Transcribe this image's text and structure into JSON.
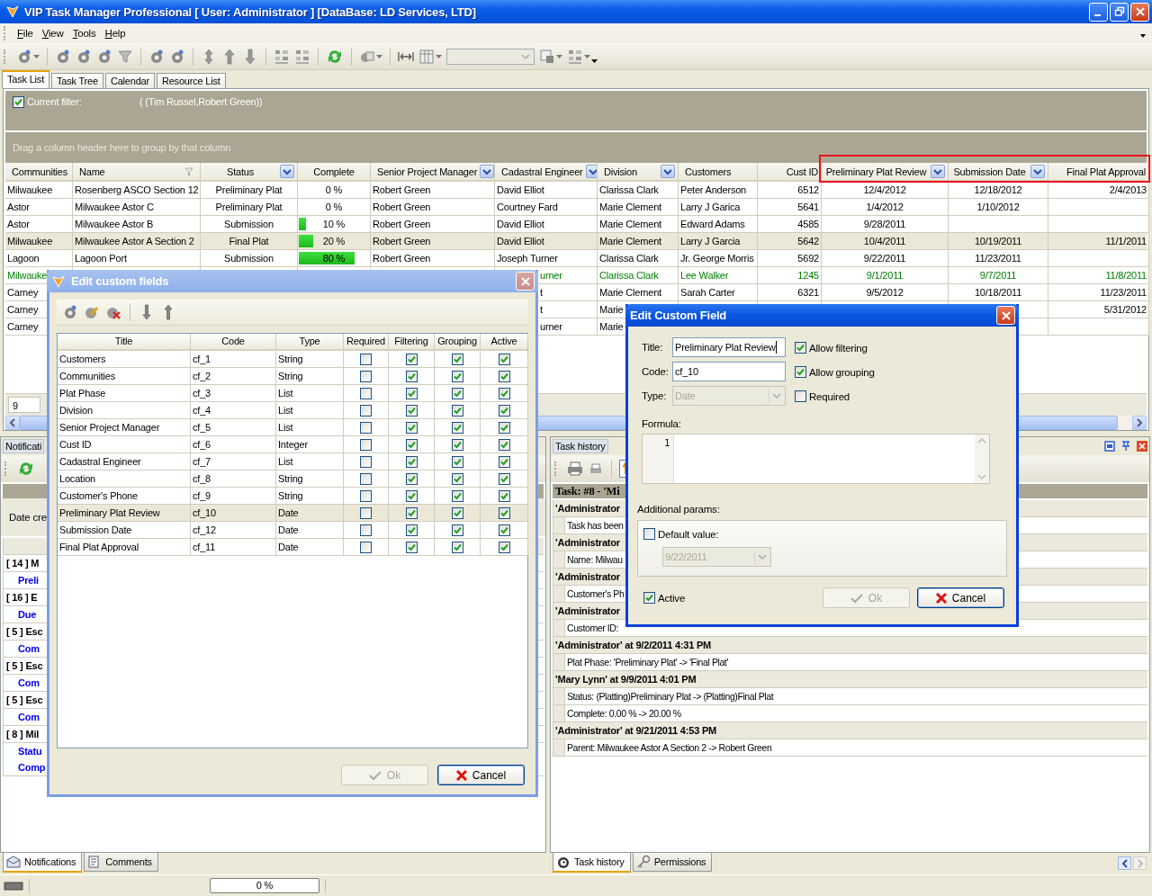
{
  "window": {
    "title": "VIP Task Manager Professional [ User: Administrator ] [DataBase: LD Services, LTD]"
  },
  "menu": [
    "File",
    "View",
    "Tools",
    "Help"
  ],
  "view_tabs": [
    {
      "label": "Task List",
      "selected": true
    },
    {
      "label": "Task Tree",
      "selected": false
    },
    {
      "label": "Calendar",
      "selected": false
    },
    {
      "label": "Resource List",
      "selected": false
    }
  ],
  "filter": {
    "checked": true,
    "label": "Current filter:",
    "value": "( (Tim Russel,Robert Green))"
  },
  "group_hint": "Drag a column header here to group by that column",
  "grid": {
    "columns": [
      {
        "label": "Communities",
        "menu_button": false,
        "funnel": false
      },
      {
        "label": "Name",
        "menu_button": false,
        "funnel": true
      },
      {
        "label": "Status",
        "menu_button": true,
        "funnel": false
      },
      {
        "label": "Complete",
        "menu_button": false,
        "funnel": false
      },
      {
        "label": "Senior Project Manager",
        "menu_button": true,
        "funnel": false
      },
      {
        "label": "Cadastral Engineer",
        "menu_button": true,
        "funnel": false
      },
      {
        "label": "Division",
        "menu_button": true,
        "funnel": false
      },
      {
        "label": "Customers",
        "menu_button": false,
        "funnel": false
      },
      {
        "label": "Cust ID",
        "menu_button": false,
        "funnel": false
      },
      {
        "label": "Preliminary Plat Review",
        "menu_button": true,
        "funnel": false,
        "marked": true
      },
      {
        "label": "Submission Date",
        "menu_button": true,
        "funnel": false,
        "marked": true
      },
      {
        "label": "Final Plat Approval",
        "menu_button": false,
        "funnel": false,
        "marked": true
      }
    ],
    "rows": [
      {
        "selected": false,
        "cells": [
          "Milwaukee",
          "Rosenberg ASCO Section 12",
          "Preliminary Plat",
          "0 %",
          "Robert Green",
          "David Elliot",
          "Clarissa Clark",
          "Peter Anderson",
          "6512",
          "12/4/2012",
          "12/18/2012",
          "2/4/2013"
        ]
      },
      {
        "selected": false,
        "cells": [
          "Astor",
          "Milwaukee Astor C",
          "Preliminary Plat",
          "0 %",
          "Robert Green",
          "Courtney Fard",
          "Marie Clement",
          "Larry J Garica",
          "5641",
          "1/4/2012",
          "1/10/2012",
          null
        ]
      },
      {
        "selected": false,
        "level": 0.1,
        "cells": [
          "Astor",
          "Milwaukee Astor B",
          "Submission",
          "10 %",
          "Robert Green",
          "David Elliot",
          "Marie Clement",
          "Edward Adams",
          "4585",
          "9/28/2011",
          null,
          null
        ]
      },
      {
        "selected": true,
        "level": 0.2,
        "cells": [
          "Milwaukee",
          "Milwaukee  Astor A Section 2",
          "Final Plat",
          "20 %",
          "Robert Green",
          "David Elliot",
          "Marie Clement",
          "Larry J Garcia",
          "5642",
          "10/4/2011",
          "10/19/2011",
          "11/1/2011"
        ]
      },
      {
        "selected": false,
        "level": 0.8,
        "cells": [
          "Lagoon",
          "Lagoon Port",
          "Submission",
          "80 %",
          "Robert Green",
          "Joseph Turner",
          "Clarissa Clark",
          "Jr. George Morris",
          "5692",
          "9/22/2011",
          "11/23/2011",
          null
        ]
      },
      {
        "selected": false,
        "color": "#008000",
        "cells": [
          "Milwauke",
          null,
          null,
          null,
          null,
          {
            "text": "urner",
            "cut": true
          },
          "Clarissa Clark",
          "Lee Walker",
          "1245",
          "9/1/2011",
          "9/7/2011",
          "11/8/2011"
        ]
      },
      {
        "selected": false,
        "cells": [
          "Carney",
          null,
          null,
          null,
          null,
          {
            "text": "t",
            "cut": true
          },
          "Marie Clement",
          "Sarah Carter",
          "6321",
          "9/5/2012",
          "10/18/2011",
          "11/23/2011"
        ]
      },
      {
        "selected": false,
        "cells": [
          "Carney",
          null,
          null,
          null,
          null,
          {
            "text": "t",
            "cut": true
          },
          "Marie",
          null,
          null,
          null,
          null,
          "5/31/2012"
        ]
      },
      {
        "selected": false,
        "cells": [
          "Carney",
          null,
          null,
          null,
          null,
          {
            "text": "urner",
            "cut": true
          },
          "Marie",
          null,
          null,
          null,
          null,
          null
        ]
      }
    ],
    "footer_count": "9"
  },
  "notifications_panel": {
    "title": "Notificati",
    "column_header": "Date cre",
    "items": [
      {
        "title": "[ 14 ] M",
        "details": [
          "Preli"
        ]
      },
      {
        "title": "[ 16 ] E",
        "details": [
          "Due"
        ]
      },
      {
        "title": "[ 5 ] Esc",
        "details": [
          "Com"
        ]
      },
      {
        "title": "[ 5 ] Esc",
        "details": [
          "Com"
        ]
      },
      {
        "title": "[ 5 ] Esc",
        "details": [
          "Com"
        ]
      },
      {
        "title": "[ 8 ] Mil",
        "details": [
          "Statu",
          "Comp"
        ]
      }
    ]
  },
  "history_panel": {
    "title": "Task history",
    "task": "Task: #8 - 'Mi",
    "entries": [
      {
        "header": "'Administrator",
        "changes": [
          "Task has been"
        ]
      },
      {
        "header": "'Administrator",
        "changes": [
          "Name: Milwau"
        ]
      },
      {
        "header": "'Administrator",
        "changes": [
          "Customer's Ph"
        ]
      },
      {
        "header": "'Administrator",
        "changes": [
          "Customer ID:"
        ]
      },
      {
        "header": "'Administrator' at 9/2/2011 4:31 PM",
        "changes": [
          "Plat Phase: 'Preliminary Plat' -> 'Final Plat'"
        ]
      },
      {
        "header": "'Mary Lynn' at 9/9/2011 4:01 PM",
        "changes": [
          "Status: (Platting)Preliminary Plat -> (Platting)Final Plat",
          "Complete: 0.00 % -> 20.00 %"
        ]
      },
      {
        "header": "'Administrator' at 9/21/2011 4:53 PM",
        "changes": [
          "Parent: Milwaukee  Astor A Section 2 -> Robert Green"
        ]
      }
    ]
  },
  "left_tabs": [
    {
      "label": "Notifications",
      "selected": true
    },
    {
      "label": "Comments",
      "selected": false
    }
  ],
  "right_tabs": [
    {
      "label": "Task history",
      "selected": true
    },
    {
      "label": "Permissions",
      "selected": false
    }
  ],
  "status_bar": {
    "progress": "0 %",
    "level": 0
  },
  "fields_dialog": {
    "title": "Edit custom fields",
    "columns": [
      "Title",
      "Code",
      "Type",
      "Required",
      "Filtering",
      "Grouping",
      "Active"
    ],
    "rows": [
      {
        "title": "Customers",
        "code": "cf_1",
        "type": "String",
        "required": false,
        "filtering": true,
        "grouping": true,
        "active": true,
        "selected": false
      },
      {
        "title": "Communities",
        "code": "cf_2",
        "type": "String",
        "required": false,
        "filtering": true,
        "grouping": true,
        "active": true,
        "selected": false
      },
      {
        "title": "Plat Phase",
        "code": "cf_3",
        "type": "List",
        "required": false,
        "filtering": true,
        "grouping": true,
        "active": true,
        "selected": false
      },
      {
        "title": "Division",
        "code": "cf_4",
        "type": "List",
        "required": false,
        "filtering": true,
        "grouping": true,
        "active": true,
        "selected": false
      },
      {
        "title": "Senior Project Manager",
        "code": "cf_5",
        "type": "List",
        "required": false,
        "filtering": true,
        "grouping": true,
        "active": true,
        "selected": false
      },
      {
        "title": "Cust ID",
        "code": "cf_6",
        "type": "Integer",
        "required": false,
        "filtering": true,
        "grouping": true,
        "active": true,
        "selected": false
      },
      {
        "title": "Cadastral Engineer",
        "code": "cf_7",
        "type": "List",
        "required": false,
        "filtering": true,
        "grouping": true,
        "active": true,
        "selected": false
      },
      {
        "title": "Location",
        "code": "cf_8",
        "type": "String",
        "required": false,
        "filtering": true,
        "grouping": true,
        "active": true,
        "selected": false
      },
      {
        "title": "Customer's Phone",
        "code": "cf_9",
        "type": "String",
        "required": false,
        "filtering": true,
        "grouping": true,
        "active": true,
        "selected": false
      },
      {
        "title": "Preliminary Plat Review",
        "code": "cf_10",
        "type": "Date",
        "required": false,
        "filtering": true,
        "grouping": true,
        "active": true,
        "selected": true
      },
      {
        "title": "Submission Date",
        "code": "cf_12",
        "type": "Date",
        "required": false,
        "filtering": true,
        "grouping": true,
        "active": true,
        "selected": false
      },
      {
        "title": "Final Plat Approval",
        "code": "cf_11",
        "type": "Date",
        "required": false,
        "filtering": true,
        "grouping": true,
        "active": true,
        "selected": false
      }
    ],
    "ok": {
      "label": "Ok",
      "disabled": true
    },
    "cancel": "Cancel"
  },
  "field_dialog": {
    "title": "Edit Custom Field",
    "title_label": "Title:",
    "title_value": "Preliminary Plat Review",
    "code_label": "Code:",
    "code_value": "cf_10",
    "type_label": "Type:",
    "type_value": "Date",
    "type_disabled": true,
    "options": [
      {
        "label": "Allow filtering",
        "checked": true
      },
      {
        "label": "Allow grouping",
        "checked": true
      },
      {
        "label": "Required",
        "checked": false
      }
    ],
    "formula_label": "Formula:",
    "formula_line": "1",
    "params_label": "Additional params:",
    "default_label": "Default value:",
    "default_checked": false,
    "default_date": "9/22/2011",
    "active_label": "Active",
    "active_checked": true,
    "ok": {
      "label": "Ok",
      "disabled": true
    },
    "cancel": "Cancel"
  }
}
